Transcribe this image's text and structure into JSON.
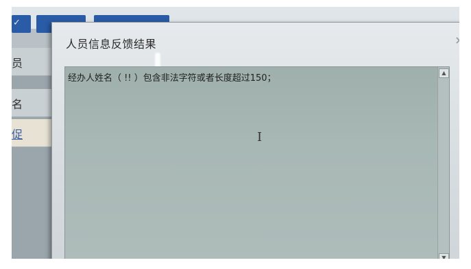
{
  "background": {
    "side_items": [
      {
        "label": "员"
      },
      {
        "label": "名"
      },
      {
        "label": "促"
      }
    ]
  },
  "dialog": {
    "title": "人员信息反馈结果",
    "close_label": "×",
    "message": "经办人姓名（ !! ）包含非法字符或者长度超过150；",
    "scroll_up": "▲",
    "scroll_down": "▼"
  },
  "colors": {
    "toolbar_button": "#2a5ba6",
    "message_area": "#a8b8b5",
    "dialog_background": "#e0e5e7"
  }
}
